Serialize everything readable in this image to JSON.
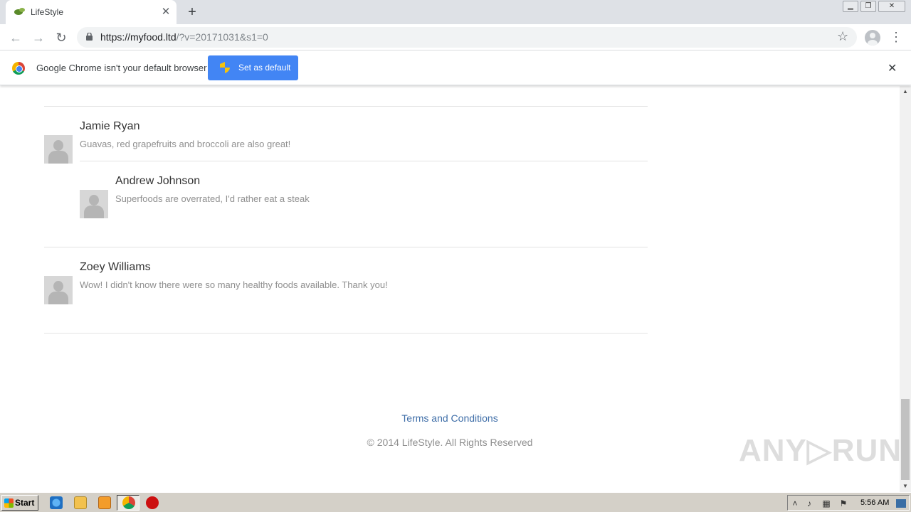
{
  "browser": {
    "tab": {
      "title": "LifeStyle"
    },
    "url": {
      "host": "https://myfood.ltd",
      "path": "/?v=20171031&s1=0"
    }
  },
  "infobar": {
    "message": "Google Chrome isn't your default browser",
    "button_label": "Set as default"
  },
  "comments": [
    {
      "name": "Jamie Ryan",
      "text": "Guavas, red grapefruits and broccoli are also great!"
    },
    {
      "name": "Andrew Johnson",
      "text": "Superfoods are overrated, I'd rather eat a steak"
    },
    {
      "name": "Zoey Williams",
      "text": "Wow! I didn't know there were so many healthy foods available. Thank you!"
    }
  ],
  "footer": {
    "link": "Terms and Conditions",
    "copyright": "© 2014 LifeStyle. All Rights Reserved"
  },
  "watermark": "ANY▷RUN",
  "taskbar": {
    "start_label": "Start",
    "clock": "5:56 AM"
  }
}
